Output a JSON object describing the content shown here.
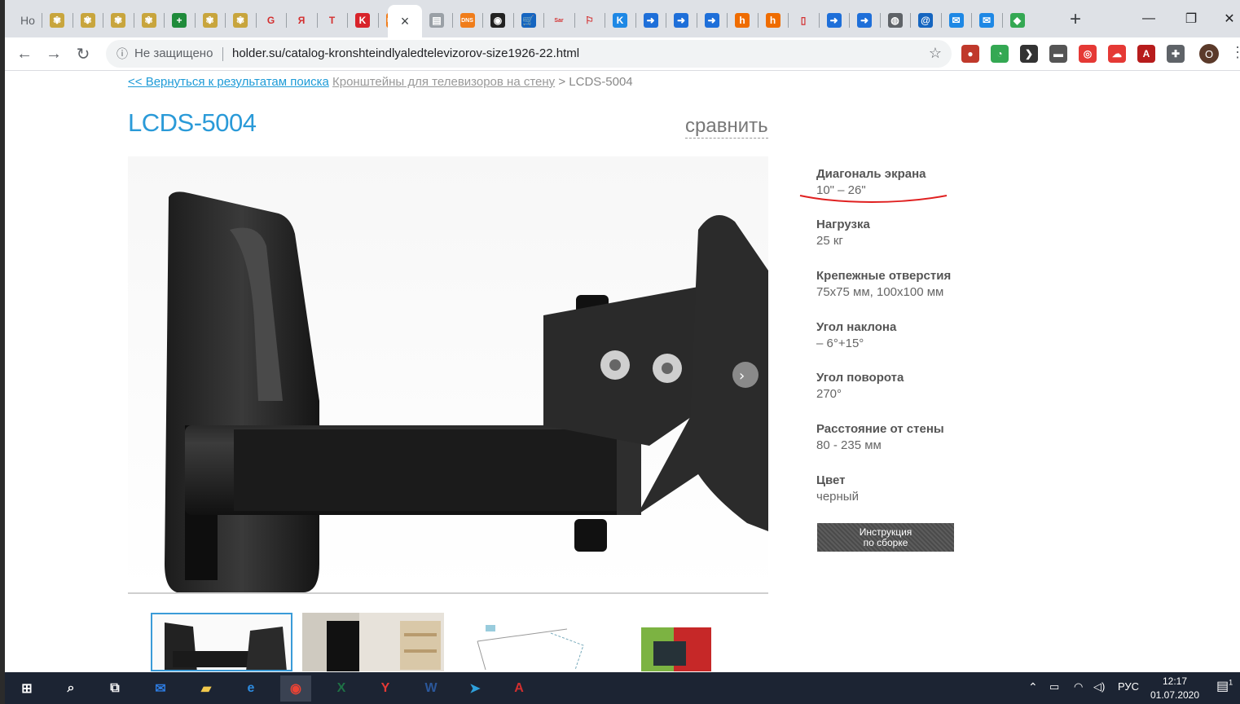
{
  "browser": {
    "first_tab_text": "Ho",
    "active_tab_close": "×",
    "new_tab": "+",
    "tabs": [
      {
        "icon": "emblem-icon",
        "color": "#c8a53d",
        "glyph": "✾"
      },
      {
        "icon": "emblem-icon",
        "color": "#c8a53d",
        "glyph": "✾"
      },
      {
        "icon": "emblem-icon",
        "color": "#c8a53d",
        "glyph": "✾"
      },
      {
        "icon": "emblem-icon",
        "color": "#c8a53d",
        "glyph": "✾"
      },
      {
        "icon": "green-plus-icon",
        "color": "#1f8b3b",
        "glyph": "+"
      },
      {
        "icon": "emblem-icon",
        "color": "#c8a53d",
        "glyph": "✾"
      },
      {
        "icon": "emblem-icon",
        "color": "#c8a53d",
        "glyph": "✾"
      },
      {
        "icon": "google-icon",
        "color": "#ffffff",
        "glyph": "G"
      },
      {
        "icon": "yandex-icon",
        "color": "#ffffff",
        "glyph": "Я"
      },
      {
        "icon": "t-icon",
        "color": "#ffffff",
        "glyph": "T"
      },
      {
        "icon": "k-icon",
        "color": "#d8232a",
        "glyph": "K"
      },
      {
        "icon": "dns-icon",
        "color": "#f07d1b",
        "glyph": "DNS"
      },
      {
        "icon": "document-icon",
        "color": "#9aa0a6",
        "glyph": "▤"
      },
      {
        "icon": "dns-icon",
        "color": "#f07d1b",
        "glyph": "DNS"
      },
      {
        "icon": "target-icon",
        "color": "#222222",
        "glyph": "◉"
      },
      {
        "icon": "cart-icon",
        "color": "#1565c0",
        "glyph": "🛒"
      },
      {
        "icon": "sar-tv-icon",
        "color": "#ffffff",
        "glyph": "Sar"
      },
      {
        "icon": "puzzle-orange-icon",
        "color": "#ffffff",
        "glyph": "⚐"
      },
      {
        "icon": "k-circle-icon",
        "color": "#1e88e5",
        "glyph": "K"
      },
      {
        "icon": "arrow-doc-icon",
        "color": "#1e6fd9",
        "glyph": "➜"
      },
      {
        "icon": "arrow-doc-icon",
        "color": "#1e6fd9",
        "glyph": "➜"
      },
      {
        "icon": "arrow-doc-icon",
        "color": "#1e6fd9",
        "glyph": "➜"
      },
      {
        "icon": "orange-h-icon",
        "color": "#ef6c00",
        "glyph": "h"
      },
      {
        "icon": "orange-h-icon",
        "color": "#ef6c00",
        "glyph": "h"
      },
      {
        "icon": "pdf-icon",
        "color": "#ffffff",
        "glyph": "▯"
      },
      {
        "icon": "arrow-doc-icon",
        "color": "#1e6fd9",
        "glyph": "➜"
      },
      {
        "icon": "arrow-doc-icon",
        "color": "#1e6fd9",
        "glyph": "➜"
      },
      {
        "icon": "globe-icon",
        "color": "#5f6368",
        "glyph": "◍"
      },
      {
        "icon": "mail-at-icon",
        "color": "#1565c0",
        "glyph": "@"
      },
      {
        "icon": "mail-icon",
        "color": "#1e88e5",
        "glyph": "✉"
      },
      {
        "icon": "mail-icon",
        "color": "#1e88e5",
        "glyph": "✉"
      },
      {
        "icon": "maps-icon",
        "color": "#34a853",
        "glyph": "◆"
      }
    ],
    "window": {
      "minimize": "—",
      "restore": "❐",
      "close": "✕"
    },
    "insecure_label": "Не защищено",
    "url": "holder.su/catalog-kronshteindlyaledtelevizorov-size1926-22.html",
    "extensions": [
      {
        "icon": "avatar-ext-icon",
        "color": "#c0392b",
        "glyph": "●"
      },
      {
        "icon": "chrome-ext-icon",
        "color": "#34a853",
        "glyph": "◔"
      },
      {
        "icon": "dark-ext-icon",
        "color": "#333333",
        "glyph": "❯"
      },
      {
        "icon": "hat-ext-icon",
        "color": "#555555",
        "glyph": "▬"
      },
      {
        "icon": "red-ring-ext-icon",
        "color": "#e53935",
        "glyph": "◎"
      },
      {
        "icon": "cloud-ext-icon",
        "color": "#e53935",
        "glyph": "☁"
      },
      {
        "icon": "acrobat-ext-icon",
        "color": "#b71c1c",
        "glyph": "A"
      },
      {
        "icon": "puzzle-ext-icon",
        "color": "#5f6368",
        "glyph": "✚"
      }
    ],
    "profile_initial": "O"
  },
  "page": {
    "breadcrumb": {
      "back_prefix": "<< ",
      "back_link": "Вернуться к результатам поиска",
      "category": "Кронштейны для телевизоров на стену",
      "separator": " > ",
      "current": "LCDS-5004"
    },
    "title": "LCDS-5004",
    "compare": "сравнить",
    "specs": [
      {
        "label": "Диагональ экрана",
        "value": "10\" – 26\""
      },
      {
        "label": "Нагрузка",
        "value": "25 кг"
      },
      {
        "label": "Крепежные отверстия",
        "value": "75x75 мм, 100x100 мм"
      },
      {
        "label": "Угол наклона",
        "value": "– 6°+15°"
      },
      {
        "label": "Угол поворота",
        "value": "270°"
      },
      {
        "label": "Расстояние от стены",
        "value": "80 - 235 мм"
      },
      {
        "label": "Цвет",
        "value": "черный"
      }
    ],
    "manual_button": {
      "line1": "Инструкция",
      "line2": "по сборке"
    },
    "accent_color": "#2a9ad8",
    "annotation_color": "#e02020"
  },
  "taskbar": {
    "apps": [
      {
        "icon": "windows-start-icon",
        "glyph": "⊞"
      },
      {
        "icon": "search-icon",
        "glyph": "⌕"
      },
      {
        "icon": "task-view-icon",
        "glyph": "⧉"
      },
      {
        "icon": "mail-app-icon",
        "glyph": "✉"
      },
      {
        "icon": "file-explorer-icon",
        "glyph": "▰"
      },
      {
        "icon": "edge-icon",
        "glyph": "e"
      },
      {
        "icon": "chrome-icon",
        "glyph": "◉"
      },
      {
        "icon": "excel-icon",
        "glyph": "X"
      },
      {
        "icon": "yandex-browser-icon",
        "glyph": "Y"
      },
      {
        "icon": "word-icon",
        "glyph": "W"
      },
      {
        "icon": "telegram-icon",
        "glyph": "➤"
      },
      {
        "icon": "acrobat-icon",
        "glyph": "A"
      }
    ],
    "lang": "РУС",
    "time": "12:17",
    "date": "01.07.2020",
    "notification_count": "1"
  }
}
